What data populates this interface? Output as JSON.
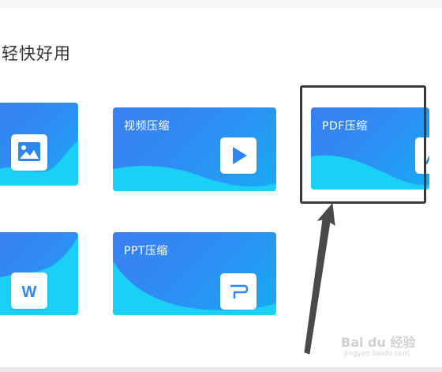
{
  "section": {
    "title": "轻快好用"
  },
  "cards": {
    "image": {
      "label": "",
      "icon": "image-icon"
    },
    "video": {
      "label": "视频压缩",
      "icon": "play-icon"
    },
    "pdf": {
      "label": "PDF压缩",
      "icon": "pdf-icon"
    },
    "word": {
      "label": "",
      "icon": "word-icon",
      "icon_text": "W"
    },
    "ppt": {
      "label": "PPT压缩",
      "icon": "ppt-icon"
    }
  },
  "colors": {
    "card_blue": "#2f8cf3",
    "wave_cyan": "#1bd3f6",
    "highlight_border": "#3a3a3a"
  },
  "watermark": {
    "brand": "Bai du 经验",
    "url": "jingyan.baidu.com"
  }
}
